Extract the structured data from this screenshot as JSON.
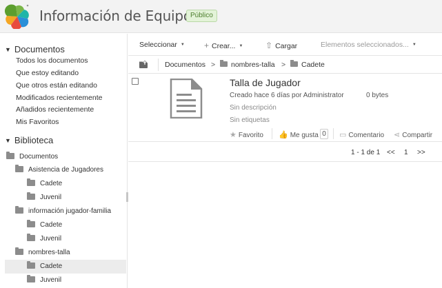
{
  "header": {
    "title": "Información de Equipos",
    "badge": "Público",
    "logo_colors": [
      "#2a8fd8",
      "#f5a623",
      "#7ab648",
      "#1fb5a8",
      "#e84c3d"
    ]
  },
  "sidebar": {
    "documents_heading": "Documentos",
    "links": [
      "Todos los documentos",
      "Que estoy editando",
      "Que otros están editando",
      "Modificados recientemente",
      "Añadidos recientemente",
      "Mis Favoritos"
    ],
    "library_heading": "Biblioteca",
    "tree": [
      {
        "label": "Documentos",
        "level": 0
      },
      {
        "label": "Asistencia de Jugadores",
        "level": 1
      },
      {
        "label": "Cadete",
        "level": 2
      },
      {
        "label": "Juvenil",
        "level": 2
      },
      {
        "label": "información jugador-familia",
        "level": 1
      },
      {
        "label": "Cadete",
        "level": 2
      },
      {
        "label": "Juvenil",
        "level": 2
      },
      {
        "label": "nombres-talla",
        "level": 1
      },
      {
        "label": "Cadete",
        "level": 2,
        "selected": true
      },
      {
        "label": "Juvenil",
        "level": 2
      }
    ]
  },
  "toolbar": {
    "select_label": "Seleccionar",
    "create_label": "Crear...",
    "upload_label": "Cargar",
    "selected_items_label": "Elementos seleccionados..."
  },
  "breadcrumb": {
    "items": [
      "Documentos",
      "nombres-talla",
      "Cadete"
    ],
    "separator": ">"
  },
  "document": {
    "title": "Talla de Jugador",
    "meta": "Creado hace 6 días por Administrator",
    "size": "0 bytes",
    "description": "Sin descripción",
    "tags": "Sin etiquetas",
    "favorite_label": "Favorito",
    "like_label": "Me gusta",
    "like_count": "0",
    "comment_label": "Comentario",
    "share_label": "Compartir"
  },
  "pager": {
    "range": "1 - 1 de 1",
    "prev": "<<",
    "page": "1",
    "next": ">>"
  }
}
